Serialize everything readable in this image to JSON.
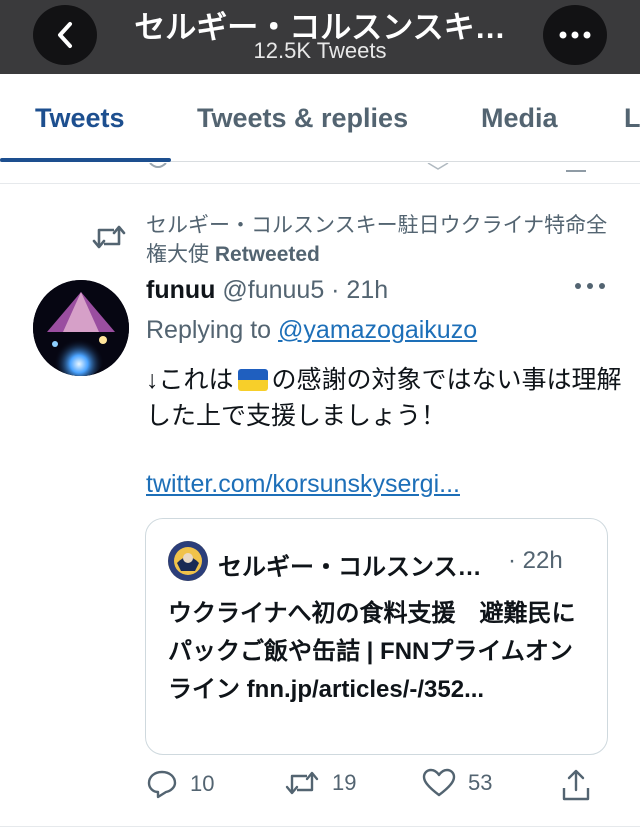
{
  "header": {
    "title": "セルギー・コルスンスキ…",
    "subtitle": "12.5K Tweets",
    "back_icon": "chevron-left-icon",
    "more_icon": "ellipsis-icon",
    "background": "#3a3a3c"
  },
  "tabs": [
    {
      "label": "Tweets",
      "active": true
    },
    {
      "label": "Tweets & replies",
      "active": false
    },
    {
      "label": "Media",
      "active": false
    },
    {
      "label": "L",
      "active": false
    }
  ],
  "tweet": {
    "retweet_by": "セルギー・コルスンスキー駐日ウクライナ特命全権大使",
    "retweet_suffix": "Retweeted",
    "author_name": "funuu",
    "author_meta": "@funuu5 · 21h",
    "reply_prefix": "Replying to",
    "reply_handle": "@yamazogaikuzo",
    "body_before_flag": "↓これは",
    "body_after_flag": "の感謝の対象ではない事は理解した上で支援しましょう！",
    "link": "twitter.com/korsunskysergi...",
    "quote": {
      "name": "セルギー・コルスンス…",
      "time": "· 22h",
      "text": "ウクライナへ初の食料支援　避難民にパックご飯や缶詰 | FNNプライムオンライン fnn.jp/articles/-/352..."
    },
    "actions": {
      "replies": "10",
      "retweets": "19",
      "likes": "53"
    }
  },
  "colors": {
    "accent": "#1d4f8f",
    "link": "#1d6fb8",
    "muted": "#536471",
    "flag_blue": "#1f5fbf",
    "flag_yellow": "#f7cf2a"
  }
}
